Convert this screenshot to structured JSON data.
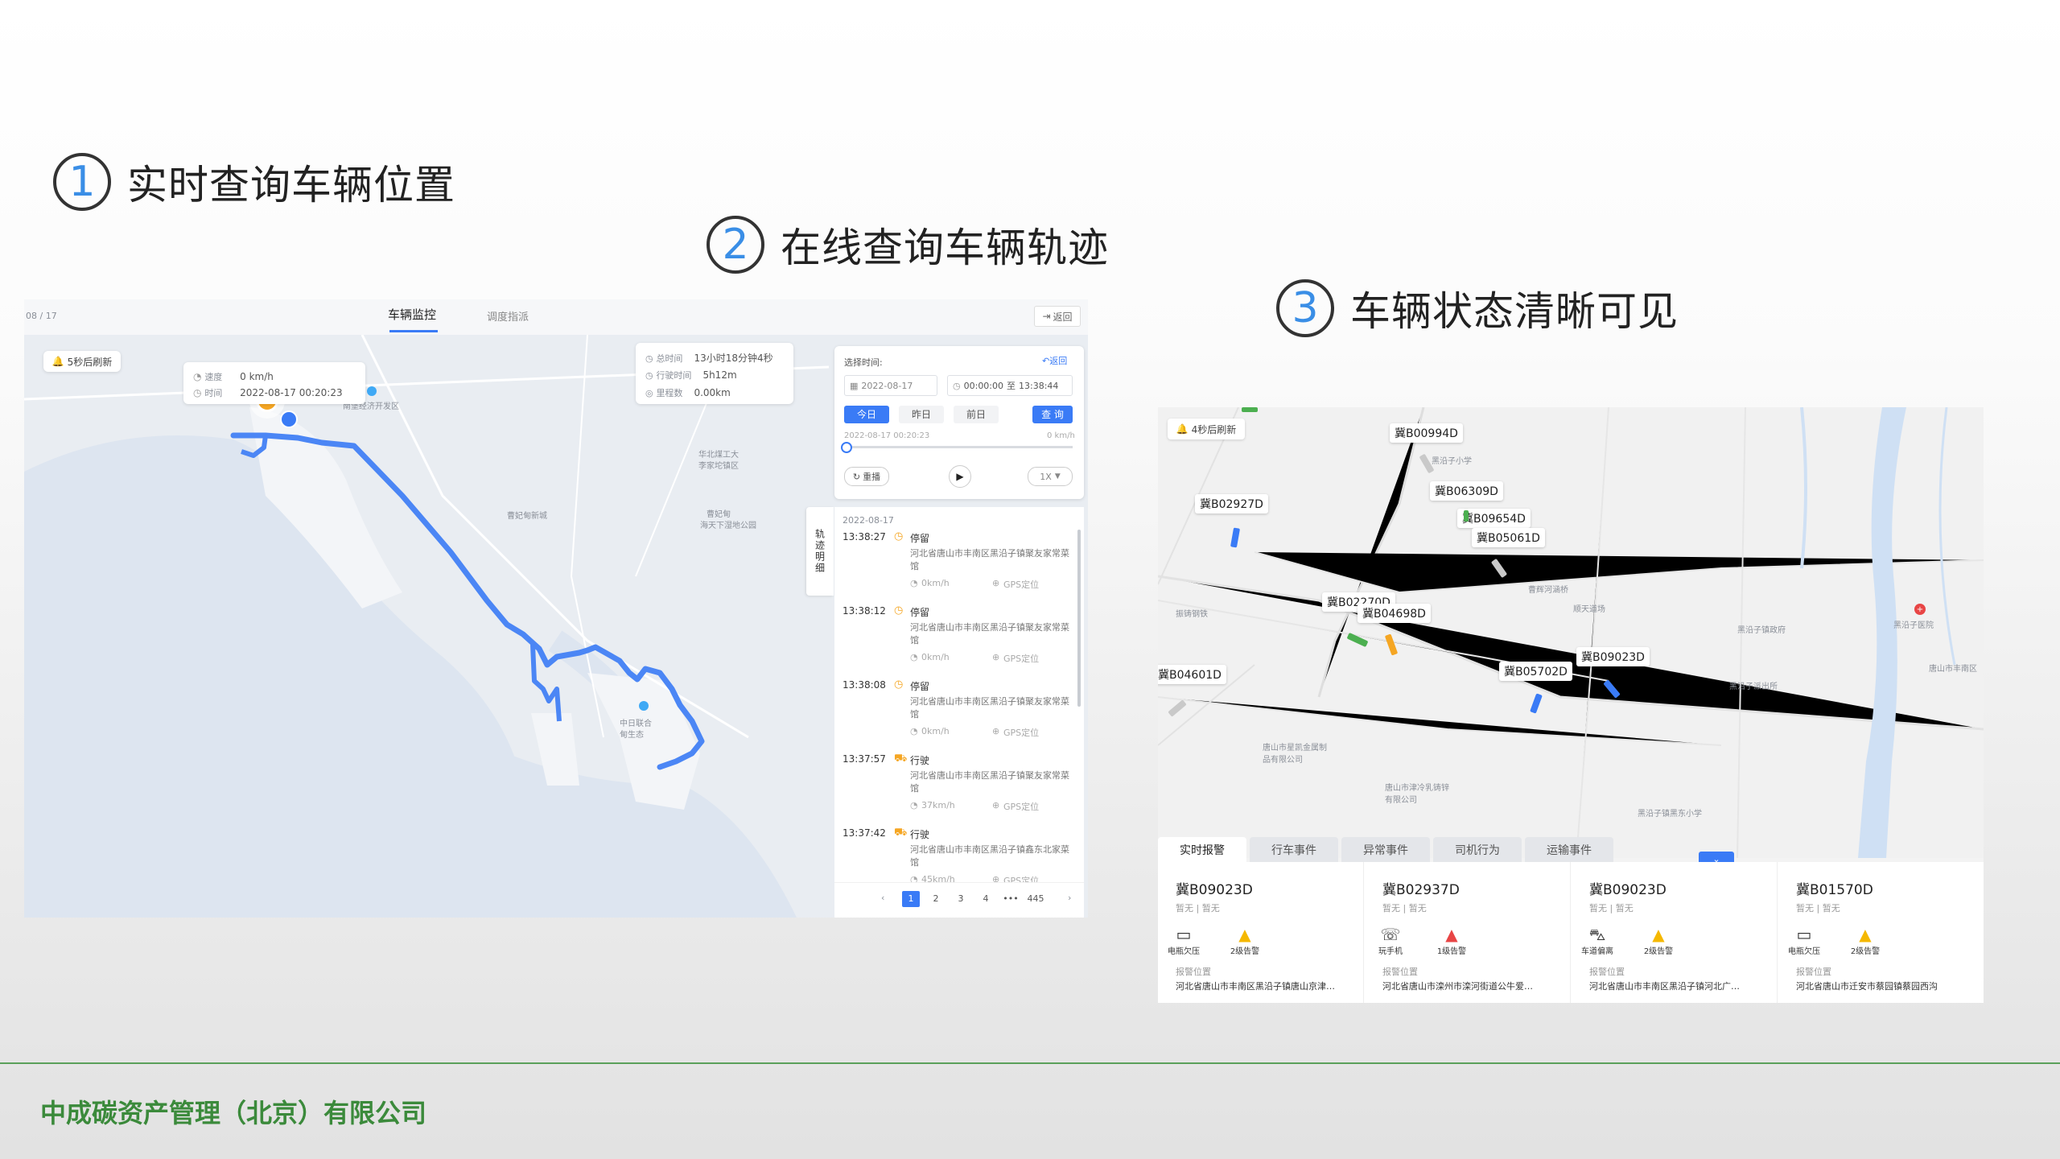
{
  "headings": [
    {
      "num": "1",
      "text": "实时查询车辆位置"
    },
    {
      "num": "2",
      "text": "在线查询车辆轨迹"
    },
    {
      "num": "3",
      "text": "车辆状态清晰可见"
    }
  ],
  "panel1": {
    "top_left": "08 / 17",
    "tabs": [
      "车辆监控",
      "调度指派"
    ],
    "back": "返回",
    "refresh": "5秒后刷新",
    "vehicle_card": {
      "speed_label": "速度",
      "speed": "0 km/h",
      "time_label": "时间",
      "time": "2022-08-17 00:20:23"
    },
    "summary": {
      "total_label": "总时间",
      "total": "13小时18分钟4秒",
      "drive_label": "行驶时间",
      "drive": "5h12m",
      "mileage_label": "里程数",
      "mileage": "0.00km"
    },
    "map_labels": [
      "南堡经济开发区",
      "华北煤工大",
      "李家坨镇区",
      "曹妃甸新城",
      "曹妃甸",
      "海天下湿地公园",
      "中日联合",
      "甸生态"
    ],
    "time_panel": {
      "title": "选择时间:",
      "back": "返回",
      "date": "2022-08-17",
      "time_start": "00:00:00",
      "time_sep": "至",
      "time_end": "13:38:44",
      "quick": [
        "今日",
        "昨日",
        "前日"
      ],
      "query": "查 询",
      "progress_time": "2022-08-17 00:20:23",
      "progress_speed": "0 km/h",
      "progress": 0.0,
      "replay": "重播",
      "speed_sel": "1X"
    },
    "track_tab": "轨迹明细",
    "track_date": "2022-08-17",
    "track_items": [
      {
        "time": "13:38:27",
        "status": "停留",
        "addr": "河北省唐山市丰南区黑沿子镇聚友家常菜馆",
        "speed": "0km/h",
        "loc": "GPS定位"
      },
      {
        "time": "13:38:12",
        "status": "停留",
        "addr": "河北省唐山市丰南区黑沿子镇聚友家常菜馆",
        "speed": "0km/h",
        "loc": "GPS定位"
      },
      {
        "time": "13:38:08",
        "status": "停留",
        "addr": "河北省唐山市丰南区黑沿子镇聚友家常菜馆",
        "speed": "0km/h",
        "loc": "GPS定位"
      },
      {
        "time": "13:37:57",
        "status": "行驶",
        "addr": "河北省唐山市丰南区黑沿子镇聚友家常菜馆",
        "speed": "37km/h",
        "loc": "GPS定位"
      },
      {
        "time": "13:37:42",
        "status": "行驶",
        "addr": "河北省唐山市丰南区黑沿子镇鑫东北家菜馆",
        "speed": "45km/h",
        "loc": "GPS定位"
      }
    ],
    "pagination": [
      "1",
      "2",
      "3",
      "4",
      "•••",
      "445"
    ]
  },
  "panel3": {
    "refresh": "4秒后刷新",
    "plates": [
      "冀B00994D",
      "冀B06309D",
      "冀B09654D",
      "冀B05061D",
      "冀B02927D",
      "冀B02270D",
      "冀B04698D",
      "冀B09023D",
      "冀B05702D",
      "冀B04601D"
    ],
    "map_labels": [
      "黑沿子小学",
      "曹辉河涵桥",
      "顺天道场",
      "黑沿子镇政府",
      "黑沿子派出所",
      "黑沿子医院",
      "唐山市丰南区",
      "振铸钢铁",
      "唐山市星凯金属制品有限公司",
      "唐山市津冷乳铸锌有限公司",
      "黑沿子镇黑东小学"
    ],
    "tabs": [
      "实时报警",
      "行车事件",
      "异常事件",
      "司机行为",
      "运输事件"
    ],
    "alarms": [
      {
        "plate": "冀B09023D",
        "sub": "暂无 | 暂无",
        "icon1": "电瓶欠压",
        "icon2": "2级告警",
        "loc_label": "报警位置",
        "loc": "河北省唐山市丰南区黑沿子镇唐山京津…"
      },
      {
        "plate": "冀B02937D",
        "sub": "暂无 | 暂无",
        "icon1": "玩手机",
        "icon2": "1级告警",
        "loc_label": "报警位置",
        "loc": "河北省唐山市滦州市滦河街道公牛爱…"
      },
      {
        "plate": "冀B09023D",
        "sub": "暂无 | 暂无",
        "icon1": "车道偏离",
        "icon2": "2级告警",
        "loc_label": "报警位置",
        "loc": "河北省唐山市丰南区黑沿子镇河北广…"
      },
      {
        "plate": "冀B01570D",
        "sub": "暂无 | 暂无",
        "icon1": "电瓶欠压",
        "icon2": "2级告警",
        "loc_label": "报警位置",
        "loc": "河北省唐山市迁安市蔡园镇蔡园西沟"
      }
    ]
  },
  "footer": "中成碳资产管理（北京）有限公司",
  "colors": {
    "accent": "#3a7bf6",
    "route": "#4b86f5",
    "footer_green": "#3b8a3b",
    "warn_yellow": "#f5b800",
    "warn_red": "#e84545"
  }
}
